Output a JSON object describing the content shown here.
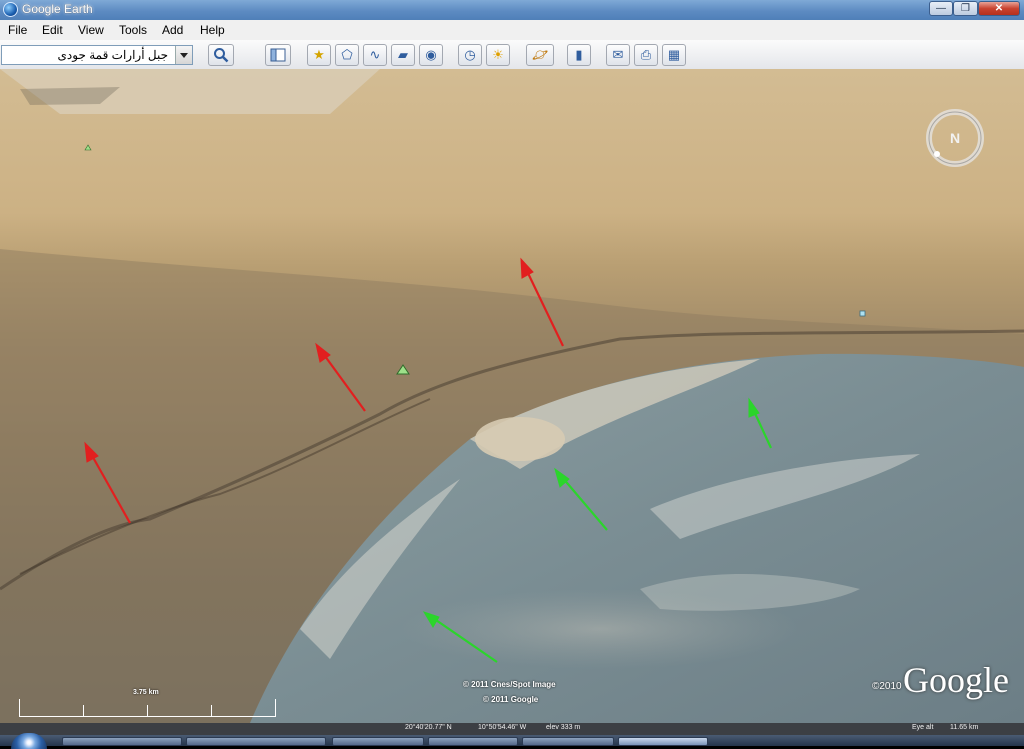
{
  "window": {
    "title": "Google Earth",
    "min_symbol": "—",
    "max_symbol": "❐",
    "close_symbol": "✕"
  },
  "menu": {
    "items": [
      "File",
      "Edit",
      "View",
      "Tools",
      "Add",
      "Help"
    ]
  },
  "search": {
    "value": "جبل أرارات قمة جودى"
  },
  "toolbar": {
    "icons": [
      "search-icon",
      "sidebar-toggle-icon",
      "placemark-icon",
      "polygon-icon",
      "path-icon",
      "image-overlay-icon",
      "record-tour-icon",
      "historical-imagery-icon",
      "sunlight-icon",
      "planets-icon",
      "ruler-icon",
      "email-icon",
      "print-icon",
      "view-in-maps-icon"
    ]
  },
  "overlay": {
    "copyright_imagery": "© 2011 Cnes/Spot Image",
    "copyright_google": "© 2011 Google",
    "copyright_year": "©2010",
    "logo": "Google",
    "scale_label": "3.75 km"
  },
  "status": {
    "lat": "20°40'20.77\" N",
    "lon": "10°50'54.46\" W",
    "elev": "elev 333 m",
    "eye": "Eye alt",
    "eye_alt": "11.65 km"
  },
  "arrows": {
    "red_color": "#e21f1f",
    "green_color": "#2bd52b"
  },
  "colors": {
    "title_bar": "#5d8bc2",
    "toolbar_bg": "#eeeff2",
    "status_bar": "#3c3f44"
  }
}
